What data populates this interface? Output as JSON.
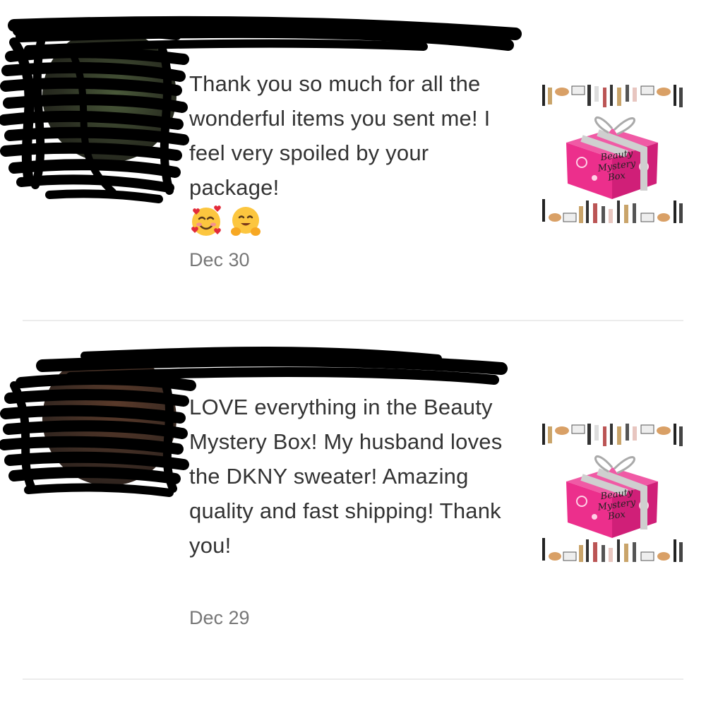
{
  "reviews": [
    {
      "text": "Thank you so much for all the wonderful items you sent me! I feel very spoiled by your package!",
      "emojis": [
        "smiling-face-with-hearts",
        "hugging-face"
      ],
      "date": "Dec 30",
      "product": {
        "label_lines": [
          "Beauty",
          "Mystery",
          "Box"
        ],
        "box_color": "#ec2f8c"
      }
    },
    {
      "text": "LOVE everything in the Beauty Mystery Box! My husband loves the DKNY sweater! Amazing quality and fast shipping! Thank you!",
      "emojis": [],
      "date": "Dec 29",
      "product": {
        "label_lines": [
          "Beauty",
          "Mystery",
          "Box"
        ],
        "box_color": "#ec2f8c"
      }
    }
  ],
  "colors": {
    "text": "#333333",
    "date": "#777777",
    "divider": "#ececec",
    "redaction": "#000000"
  }
}
